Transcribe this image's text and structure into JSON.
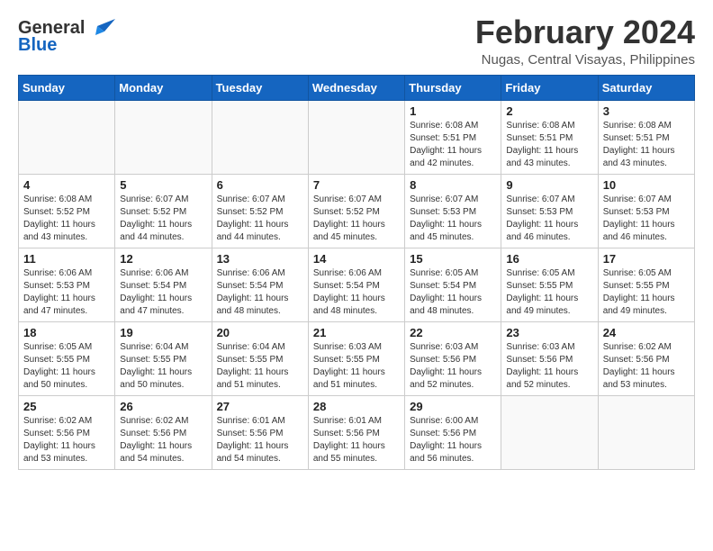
{
  "logo": {
    "general": "General",
    "blue": "Blue"
  },
  "title": "February 2024",
  "subtitle": "Nugas, Central Visayas, Philippines",
  "days_header": [
    "Sunday",
    "Monday",
    "Tuesday",
    "Wednesday",
    "Thursday",
    "Friday",
    "Saturday"
  ],
  "weeks": [
    [
      {
        "num": "",
        "info": ""
      },
      {
        "num": "",
        "info": ""
      },
      {
        "num": "",
        "info": ""
      },
      {
        "num": "",
        "info": ""
      },
      {
        "num": "1",
        "info": "Sunrise: 6:08 AM\nSunset: 5:51 PM\nDaylight: 11 hours and 42 minutes."
      },
      {
        "num": "2",
        "info": "Sunrise: 6:08 AM\nSunset: 5:51 PM\nDaylight: 11 hours and 43 minutes."
      },
      {
        "num": "3",
        "info": "Sunrise: 6:08 AM\nSunset: 5:51 PM\nDaylight: 11 hours and 43 minutes."
      }
    ],
    [
      {
        "num": "4",
        "info": "Sunrise: 6:08 AM\nSunset: 5:52 PM\nDaylight: 11 hours and 43 minutes."
      },
      {
        "num": "5",
        "info": "Sunrise: 6:07 AM\nSunset: 5:52 PM\nDaylight: 11 hours and 44 minutes."
      },
      {
        "num": "6",
        "info": "Sunrise: 6:07 AM\nSunset: 5:52 PM\nDaylight: 11 hours and 44 minutes."
      },
      {
        "num": "7",
        "info": "Sunrise: 6:07 AM\nSunset: 5:52 PM\nDaylight: 11 hours and 45 minutes."
      },
      {
        "num": "8",
        "info": "Sunrise: 6:07 AM\nSunset: 5:53 PM\nDaylight: 11 hours and 45 minutes."
      },
      {
        "num": "9",
        "info": "Sunrise: 6:07 AM\nSunset: 5:53 PM\nDaylight: 11 hours and 46 minutes."
      },
      {
        "num": "10",
        "info": "Sunrise: 6:07 AM\nSunset: 5:53 PM\nDaylight: 11 hours and 46 minutes."
      }
    ],
    [
      {
        "num": "11",
        "info": "Sunrise: 6:06 AM\nSunset: 5:53 PM\nDaylight: 11 hours and 47 minutes."
      },
      {
        "num": "12",
        "info": "Sunrise: 6:06 AM\nSunset: 5:54 PM\nDaylight: 11 hours and 47 minutes."
      },
      {
        "num": "13",
        "info": "Sunrise: 6:06 AM\nSunset: 5:54 PM\nDaylight: 11 hours and 48 minutes."
      },
      {
        "num": "14",
        "info": "Sunrise: 6:06 AM\nSunset: 5:54 PM\nDaylight: 11 hours and 48 minutes."
      },
      {
        "num": "15",
        "info": "Sunrise: 6:05 AM\nSunset: 5:54 PM\nDaylight: 11 hours and 48 minutes."
      },
      {
        "num": "16",
        "info": "Sunrise: 6:05 AM\nSunset: 5:55 PM\nDaylight: 11 hours and 49 minutes."
      },
      {
        "num": "17",
        "info": "Sunrise: 6:05 AM\nSunset: 5:55 PM\nDaylight: 11 hours and 49 minutes."
      }
    ],
    [
      {
        "num": "18",
        "info": "Sunrise: 6:05 AM\nSunset: 5:55 PM\nDaylight: 11 hours and 50 minutes."
      },
      {
        "num": "19",
        "info": "Sunrise: 6:04 AM\nSunset: 5:55 PM\nDaylight: 11 hours and 50 minutes."
      },
      {
        "num": "20",
        "info": "Sunrise: 6:04 AM\nSunset: 5:55 PM\nDaylight: 11 hours and 51 minutes."
      },
      {
        "num": "21",
        "info": "Sunrise: 6:03 AM\nSunset: 5:55 PM\nDaylight: 11 hours and 51 minutes."
      },
      {
        "num": "22",
        "info": "Sunrise: 6:03 AM\nSunset: 5:56 PM\nDaylight: 11 hours and 52 minutes."
      },
      {
        "num": "23",
        "info": "Sunrise: 6:03 AM\nSunset: 5:56 PM\nDaylight: 11 hours and 52 minutes."
      },
      {
        "num": "24",
        "info": "Sunrise: 6:02 AM\nSunset: 5:56 PM\nDaylight: 11 hours and 53 minutes."
      }
    ],
    [
      {
        "num": "25",
        "info": "Sunrise: 6:02 AM\nSunset: 5:56 PM\nDaylight: 11 hours and 53 minutes."
      },
      {
        "num": "26",
        "info": "Sunrise: 6:02 AM\nSunset: 5:56 PM\nDaylight: 11 hours and 54 minutes."
      },
      {
        "num": "27",
        "info": "Sunrise: 6:01 AM\nSunset: 5:56 PM\nDaylight: 11 hours and 54 minutes."
      },
      {
        "num": "28",
        "info": "Sunrise: 6:01 AM\nSunset: 5:56 PM\nDaylight: 11 hours and 55 minutes."
      },
      {
        "num": "29",
        "info": "Sunrise: 6:00 AM\nSunset: 5:56 PM\nDaylight: 11 hours and 56 minutes."
      },
      {
        "num": "",
        "info": ""
      },
      {
        "num": "",
        "info": ""
      }
    ]
  ]
}
